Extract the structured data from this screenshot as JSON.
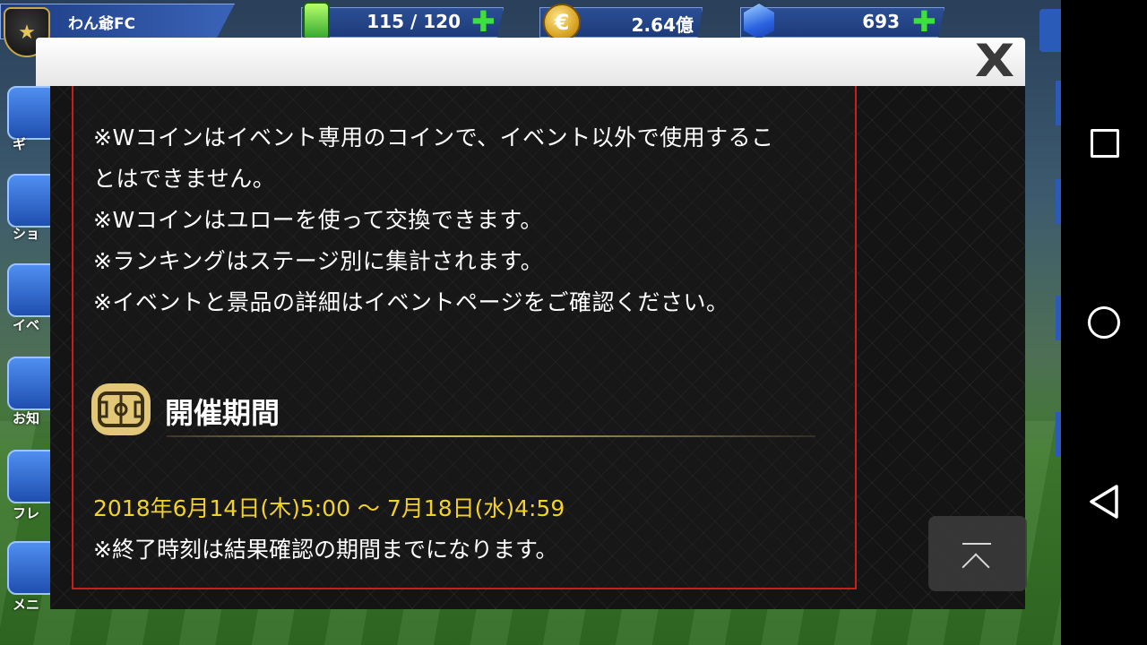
{
  "hud": {
    "team_name": "わん爺FC",
    "stamina": "115 / 120",
    "coins": "2.64億",
    "gems": "693",
    "plus_glyph": "✚",
    "coin_glyph": "€"
  },
  "side_menu": {
    "labels": [
      "ギ",
      "ショ",
      "イベ",
      "お知",
      "フレ",
      "メニ"
    ]
  },
  "modal": {
    "close_label": "X",
    "notes": [
      "※Wコインはイベント専用のコインで、イベント以外で使用するこ",
      "とはできません。",
      "※Wコインはユローを使って交換できます。",
      "※ランキングはステージ別に集計されます。",
      "※イベントと景品の詳細はイベントページをご確認ください。"
    ],
    "section_title": "開催期間",
    "period": "2018年6月14日(木)5:00 〜 7月18日(水)4:59",
    "period_note": "※終了時刻は結果確認の期間までになります。"
  },
  "colors": {
    "accent_red": "#c81e1e",
    "period_yellow": "#f2d22a",
    "section_gold": "#e2c779"
  },
  "icons": {
    "close": "close-icon",
    "section": "field-icon",
    "scroll_top": "scroll-to-top-icon",
    "nav_recents": "square-icon",
    "nav_home": "circle-icon",
    "nav_back": "triangle-back-icon"
  }
}
